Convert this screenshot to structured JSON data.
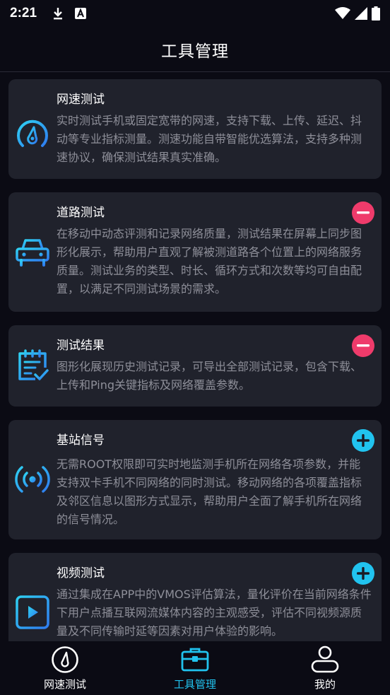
{
  "status_bar": {
    "time": "2:21",
    "icons": [
      "download-icon",
      "text-a-icon",
      "wifi-icon",
      "signal-icon",
      "battery-icon"
    ]
  },
  "header": {
    "title": "工具管理"
  },
  "cards": [
    {
      "title": "网速测试",
      "description": "实时测试手机或固定宽带的网速，支持下载、上传、延迟、抖动等专业指标测量。测速功能自带智能优选算法，支持多种测速协议，确保测试结果真实准确。",
      "icon": "speedometer-icon",
      "action": "none"
    },
    {
      "title": "道路测试",
      "description": "在移动中动态评测和记录网络质量，测试结果在屏幕上同步图形化展示，帮助用户直观了解被测道路各个位置上的网络服务质量。测试业务的类型、时长、循环方式和次数等均可自由配置，以满足不同测试场景的需求。",
      "icon": "car-icon",
      "action": "remove"
    },
    {
      "title": "测试结果",
      "description": "图形化展现历史测试记录，可导出全部测试记录，包含下载、上传和Ping关键指标及网络覆盖参数。",
      "icon": "clipboard-check-icon",
      "action": "remove"
    },
    {
      "title": "基站信号",
      "description": "无需ROOT权限即可实时地监测手机所在网络各项参数，并能支持双卡手机不同网络的同时测试。移动网络的各项覆盖指标及邻区信息以图形方式显示，帮助用户全面了解手机所在网络的信号情况。",
      "icon": "signal-tower-icon",
      "action": "add"
    },
    {
      "title": "视频测试",
      "description": "通过集成在APP中的VMOS评估算法，量化评价在当前网络条件下用户点播互联网流媒体内容的主观感受，评估不同视频源质量及不同传输时延等因素对用户体验的影响。",
      "icon": "video-play-icon",
      "action": "add"
    }
  ],
  "bottom_nav": {
    "items": [
      {
        "label": "网速测试",
        "icon": "speedometer-icon",
        "active": false
      },
      {
        "label": "工具管理",
        "icon": "toolbox-icon",
        "active": true
      },
      {
        "label": "我的",
        "icon": "user-icon",
        "active": false
      }
    ]
  },
  "colors": {
    "background": "#0b0b14",
    "card": "#20222c",
    "accent": "#21c3ef",
    "remove": "#ef3b6b",
    "desc_text": "#8e8f99"
  }
}
